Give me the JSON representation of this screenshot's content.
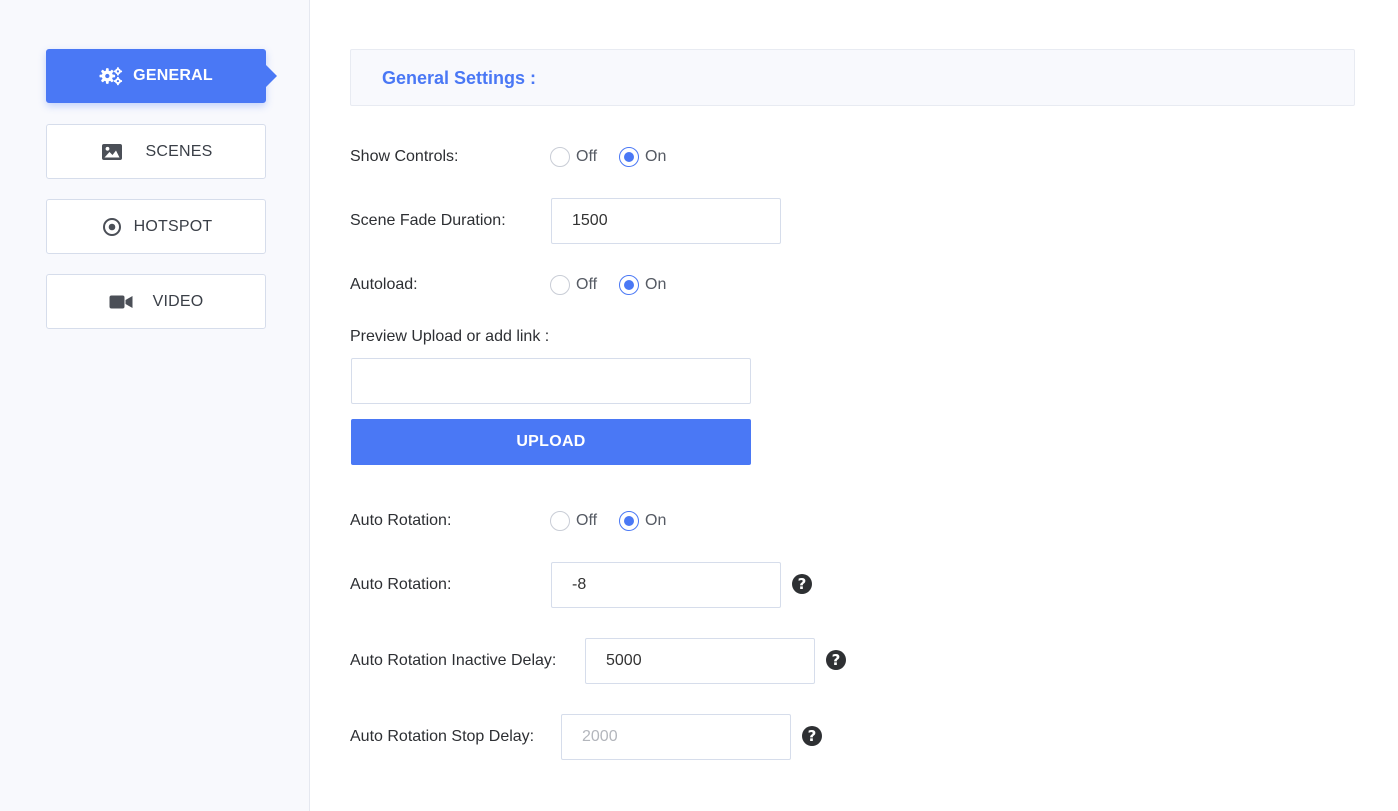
{
  "sidebar": {
    "items": [
      {
        "label": "GENERAL",
        "icon": "gears-icon",
        "active": true
      },
      {
        "label": "SCENES",
        "icon": "image-icon",
        "active": false
      },
      {
        "label": "HOTSPOT",
        "icon": "target-circle-icon",
        "active": false
      },
      {
        "label": "VIDEO",
        "icon": "video-camera-icon",
        "active": false
      }
    ]
  },
  "header": {
    "title": "General Settings :"
  },
  "form": {
    "show_controls": {
      "label": "Show Controls:",
      "off": "Off",
      "on": "On",
      "value": "On"
    },
    "scene_fade": {
      "label": "Scene Fade Duration:",
      "value": "1500"
    },
    "autoload": {
      "label": "Autoload:",
      "off": "Off",
      "on": "On",
      "value": "On"
    },
    "preview": {
      "label": "Preview Upload or add link :",
      "value": "",
      "button": "UPLOAD"
    },
    "auto_rotation_toggle": {
      "label": "Auto Rotation:",
      "off": "Off",
      "on": "On",
      "value": "On"
    },
    "auto_rotation_value": {
      "label": "Auto Rotation:",
      "value": "-8"
    },
    "inactive_delay": {
      "label": "Auto Rotation Inactive Delay:",
      "value": "5000"
    },
    "stop_delay": {
      "label": "Auto Rotation Stop Delay:",
      "placeholder": "2000"
    }
  },
  "colors": {
    "accent": "#4a78f5",
    "sidebar_bg": "#f8f9fd"
  }
}
